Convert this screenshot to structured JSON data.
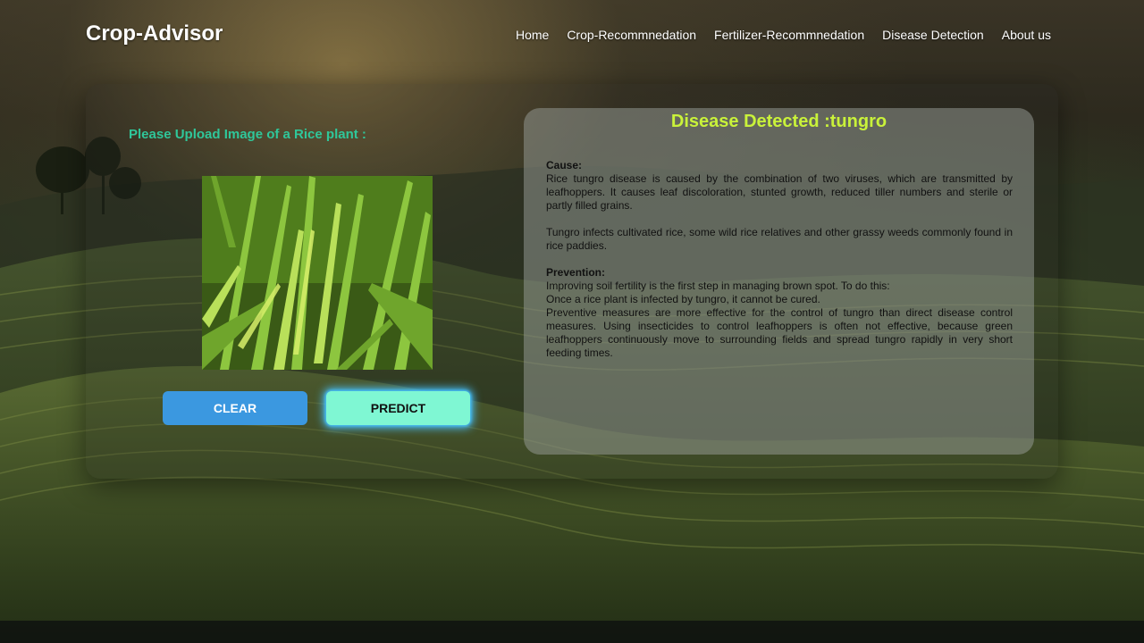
{
  "navbar": {
    "brand": "Crop-Advisor",
    "links": [
      "Home",
      "Crop-Recommnedation",
      "Fertilizer-Recommnedation",
      "Disease Detection",
      "About us"
    ]
  },
  "upload": {
    "label": "Please Upload Image of a Rice plant :"
  },
  "buttons": {
    "clear": "CLEAR",
    "predict": "PREDICT"
  },
  "result": {
    "title": "Disease Detected :tungro",
    "cause_heading": "Cause:",
    "cause_text_1": "Rice tungro disease is caused by the combination of two viruses, which are transmitted by leafhoppers. It causes leaf discoloration, stunted growth, reduced tiller numbers and sterile or partly filled grains.",
    "cause_text_2": "Tungro infects cultivated rice, some wild rice relatives and other grassy weeds commonly found in rice paddies.",
    "prevention_heading": "Prevention:",
    "prevention_line_1": "Improving soil fertility is the first step in managing brown spot. To do this:",
    "prevention_line_2": "Once a rice plant is infected by tungro, it cannot be cured.",
    "prevention_line_3": "Preventive measures are more effective for the control of tungro than direct disease control measures. Using insecticides to control leafhoppers is often not effective, because green leafhoppers continuously move to surrounding fields and spread tungro rapidly in very short feeding times."
  },
  "colors": {
    "brand_text": "#ffffff",
    "upload_label": "#2fc79a",
    "clear_button": "#3b98e0",
    "predict_button": "#7ff7d3",
    "predict_glow": "#49c4ff",
    "result_title": "#c9f23a"
  }
}
